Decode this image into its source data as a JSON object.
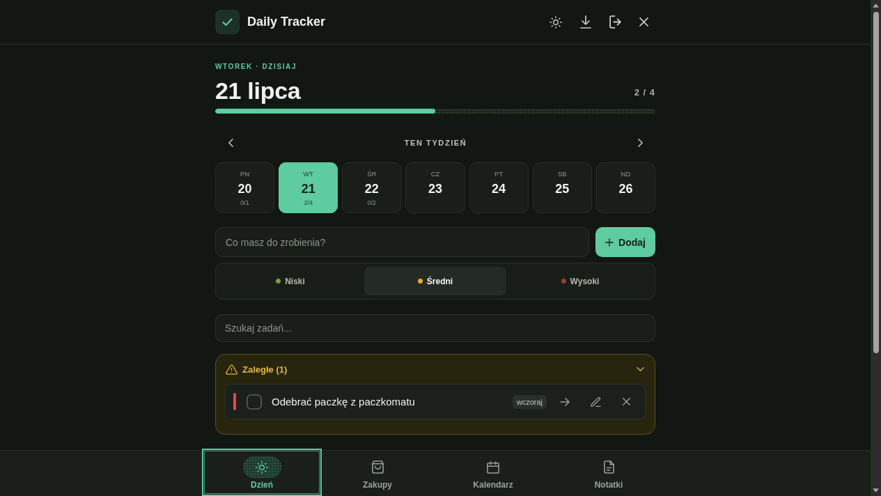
{
  "header": {
    "title": "Daily Tracker"
  },
  "day": {
    "weekday_label": "WTOREK · DZISIAJ",
    "date": "21 lipca",
    "done_count": "2 / 4",
    "progress": {
      "level": 0.5
    }
  },
  "week": {
    "label": "TEN TYDZIEŃ",
    "days": [
      {
        "name": "PN",
        "number": "20",
        "count": "0/1",
        "selected": false
      },
      {
        "name": "WT",
        "number": "21",
        "count": "2/4",
        "selected": true
      },
      {
        "name": "ŚR",
        "number": "22",
        "count": "0/2",
        "selected": false
      },
      {
        "name": "CZ",
        "number": "23",
        "selected": false
      },
      {
        "name": "PT",
        "number": "24",
        "selected": false
      },
      {
        "name": "SB",
        "number": "25",
        "selected": false
      },
      {
        "name": "ND",
        "number": "26",
        "selected": false
      }
    ]
  },
  "new_task": {
    "placeholder": "Co masz do zrobienia?",
    "add_button": "Dodaj"
  },
  "priorities": [
    {
      "label": "Niski",
      "color": "#7b9a4c",
      "selected": false
    },
    {
      "label": "Średni",
      "color": "#f0a830",
      "selected": true
    },
    {
      "label": "Wysoki",
      "color": "#9e3c36",
      "selected": false
    }
  ],
  "search": {
    "placeholder": "Szukaj zadań..."
  },
  "overdue": {
    "title": "Zaległe (1)",
    "expanded": true,
    "tasks": [
      {
        "title": "Odebrać paczkę z paczkomatu",
        "checked": false,
        "due": "wczoraj",
        "color": "#e0484c"
      }
    ]
  },
  "nav": [
    {
      "kind": "day",
      "label": "Dzień",
      "selected": true,
      "focused": true
    },
    {
      "kind": "shopping",
      "label": "Zakupy",
      "selected": false,
      "focused": false
    },
    {
      "kind": "calendar",
      "label": "Kalendarz",
      "selected": false,
      "focused": false
    },
    {
      "kind": "notes",
      "label": "Notatki",
      "selected": false,
      "focused": false
    }
  ]
}
